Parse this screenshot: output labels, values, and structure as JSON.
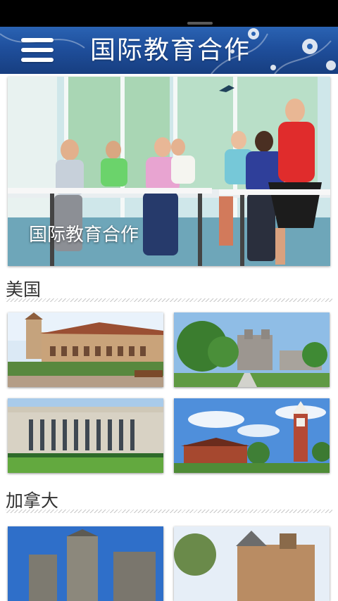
{
  "header": {
    "title": "国际教育合作",
    "menu_icon": "hamburger-menu-icon"
  },
  "hero": {
    "caption": "国际教育合作"
  },
  "sections": [
    {
      "title": "美国"
    },
    {
      "title": "加拿大"
    }
  ],
  "colors": {
    "header_blue": "#1f4f9c",
    "status_bar": "#000000",
    "section_text": "#333333"
  }
}
